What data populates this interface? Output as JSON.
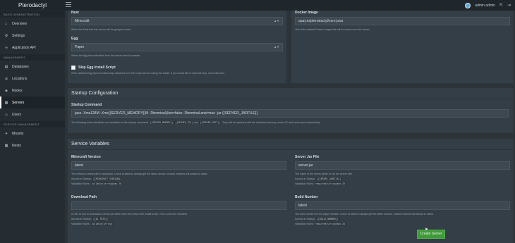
{
  "header": {
    "brand": "Pterodactyl",
    "user_name": "admin admin",
    "icons": [
      "menu-icon",
      "user-avatar-icon",
      "exit-icon",
      "logout-icon"
    ]
  },
  "sidebar": {
    "sections": [
      {
        "title": "BASIC ADMINISTRATION",
        "items": [
          {
            "label": "Overview",
            "icon": "home-icon",
            "glyph": "⌂"
          },
          {
            "label": "Settings",
            "icon": "gear-icon",
            "glyph": "⚙"
          },
          {
            "label": "Application API",
            "icon": "link-icon",
            "glyph": "∞"
          }
        ]
      },
      {
        "title": "MANAGEMENT",
        "items": [
          {
            "label": "Databases",
            "icon": "database-icon",
            "glyph": "▤"
          },
          {
            "label": "Locations",
            "icon": "globe-icon",
            "glyph": "◎"
          },
          {
            "label": "Nodes",
            "icon": "sitemap-icon",
            "glyph": "◈"
          },
          {
            "label": "Servers",
            "icon": "server-icon",
            "glyph": "▦",
            "active": true
          },
          {
            "label": "Users",
            "icon": "users-icon",
            "glyph": "☺"
          }
        ]
      },
      {
        "title": "SERVICE MANAGEMENT",
        "items": [
          {
            "label": "Mounts",
            "icon": "magic-icon",
            "glyph": "✦"
          },
          {
            "label": "Nests",
            "icon": "th-large-icon",
            "glyph": "▦"
          }
        ]
      }
    ]
  },
  "nest": {
    "label": "Nest",
    "value": "Minecraft",
    "help": "Select the Nest that this server will be grouped under."
  },
  "egg": {
    "label": "Egg",
    "value": "Paper",
    "help": "Select the Egg that will define how this server should operate."
  },
  "skip_script": {
    "label": "Skip Egg Install Script",
    "help": "If the selected Egg has an install script attached to it, the script will run during the install. If you would like to skip this step, check this box."
  },
  "docker": {
    "label": "Docker Image",
    "value": "quay.io/pterodactyl/core:java",
    "help": "This is the default Docker image that will be used to run this server."
  },
  "startup": {
    "title": "Startup Configuration",
    "label": "Startup Command",
    "value": "java -Xms128M -Xmx{{SERVER_MEMORY}}M -Dterminal.jline=false -Dterminal.ansi=true -jar {{SERVER_JARFILE}}",
    "help_pre": "The following data substitutes are available for the startup command:",
    "code1": "{{SERVER_MEMORY}}",
    "code2": "{{SERVER_IP}}",
    "help_and": "and",
    "code3": "{{SERVER_PORT}}",
    "help_post": ". They will be replaced with the allocated memory, server IP, and server port respectively."
  },
  "vars": {
    "title": "Service Variables",
    "mc_version": {
      "label": "Minecraft Version",
      "value": "latest",
      "help": "The version of minecraft to download. Leave at latest to always get the latest version. Invalid versions will default to latest.",
      "access_label": "Access in Startup:",
      "access_code": "{{MINECRAFT_VERSION}}",
      "rules_label": "Validation Rules:",
      "rules_code": "nullable|string|max:20"
    },
    "jar_file": {
      "label": "Server Jar File",
      "value": "server.jar",
      "help": "The name of the server jarfile to run the server with.",
      "access_label": "Access in Startup:",
      "access_code": "{{SERVER_JARFILE}}",
      "rules_label": "Validation Rules:",
      "rules_code": "required|string|max:20"
    },
    "dl_path": {
      "label": "Download Path",
      "value": "",
      "help": "A URL to use to download a server.jar rather than the ones in the install script. This is not user viewable.",
      "access_label": "Access in Startup:",
      "access_code": "{{DL_PATH}}",
      "rules_label": "Validation Rules:",
      "rules_code": "nullable|string"
    },
    "build_number": {
      "label": "Build Number",
      "value": "latest",
      "help": "The build number for the paper release. Leave at latest to always get the latest version. Invalid versions will default to latest.",
      "access_label": "Access in Startup:",
      "access_code": "{{BUILD_NUMBER}}",
      "rules_label": "Validation Rules:",
      "rules_code": "required|string|max:20"
    }
  },
  "create_button": "Create Server"
}
